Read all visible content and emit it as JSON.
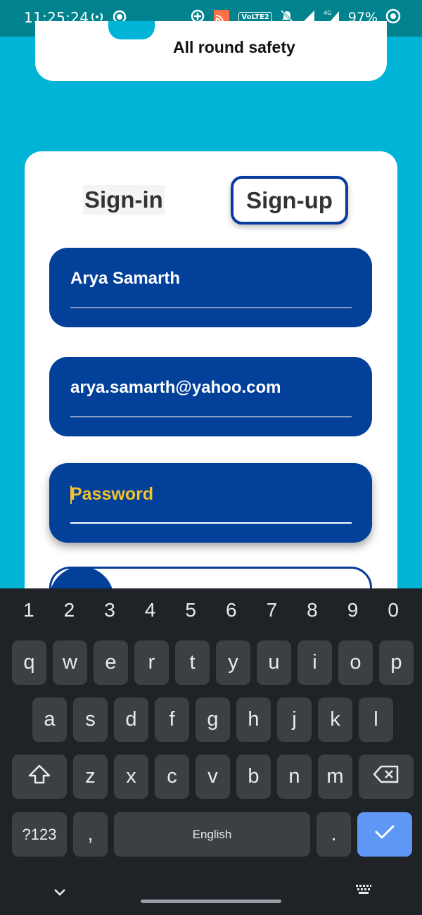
{
  "status_bar": {
    "time": "11:25:24",
    "volte": "VoLTE2",
    "network": "4G",
    "battery": "97%"
  },
  "top_card": {
    "text": "All round safety"
  },
  "tabs": {
    "signin": "Sign-in",
    "signup": "Sign-up"
  },
  "form": {
    "name_value": "Arya Samarth",
    "email_value": "arya.samarth@yahoo.com",
    "password_placeholder": "Password"
  },
  "keyboard": {
    "number_row": [
      "1",
      "2",
      "3",
      "4",
      "5",
      "6",
      "7",
      "8",
      "9",
      "0"
    ],
    "row1": [
      "q",
      "w",
      "e",
      "r",
      "t",
      "y",
      "u",
      "i",
      "o",
      "p"
    ],
    "row2": [
      "a",
      "s",
      "d",
      "f",
      "g",
      "h",
      "j",
      "k",
      "l"
    ],
    "row3": [
      "z",
      "x",
      "c",
      "v",
      "b",
      "n",
      "m"
    ],
    "symbols_label": "?123",
    "comma": ",",
    "space_label": "English",
    "period": "."
  },
  "colors": {
    "background": "#00b4d8",
    "status_bar": "#00838f",
    "field": "#02409a",
    "placeholder": "#f2c12e",
    "keyboard_bg": "#1f2227",
    "key_bg": "#3c4043",
    "enter_key": "#5e97f6"
  },
  "icons": [
    "hotspot-icon",
    "record-icon",
    "data-saver-icon",
    "cast-icon",
    "mute-icon",
    "signal-icon",
    "battery-icon",
    "shift-icon",
    "backspace-icon",
    "check-icon",
    "keyboard-hide-icon",
    "keyboard-switch-icon"
  ]
}
